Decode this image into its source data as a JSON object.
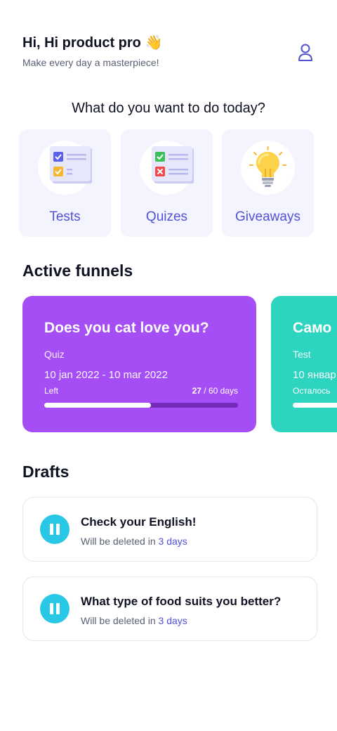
{
  "header": {
    "greeting": "Hi, Hi product pro",
    "greeting_emoji": "👋",
    "subtitle": "Make every day a masterpiece!",
    "profile_icon": "user-icon"
  },
  "question": "What do you want to do today?",
  "actions": [
    {
      "label": "Tests",
      "icon": "test-checklist-icon"
    },
    {
      "label": "Quizes",
      "icon": "quiz-checklist-icon"
    },
    {
      "label": "Giveaways",
      "icon": "lightbulb-icon"
    }
  ],
  "active_funnels": {
    "title": "Active funnels",
    "items": [
      {
        "title": "Does you cat love you?",
        "type": "Quiz",
        "dates": "10 jan 2022 - 10 mar 2022",
        "left_label": "Left",
        "days_done": "27",
        "days_total": " / 60 days",
        "progress": 0.55,
        "color": "#a64ef5"
      },
      {
        "title": "Само",
        "type": "Test",
        "dates": "10 январ",
        "left_label": "Осталось",
        "progress": 0.6,
        "color": "#2dd4bf"
      }
    ]
  },
  "drafts": {
    "title": "Drafts",
    "items": [
      {
        "title": "Check your English!",
        "sub_prefix": "Will be deleted in ",
        "sub_days": "3 days"
      },
      {
        "title": "What type of food suits you better?",
        "sub_prefix": "Will be deleted in ",
        "sub_days": "3 days"
      }
    ]
  },
  "colors": {
    "accent": "#5152d6",
    "card_bg": "#f3f4fd",
    "pause": "#29c7e6"
  }
}
